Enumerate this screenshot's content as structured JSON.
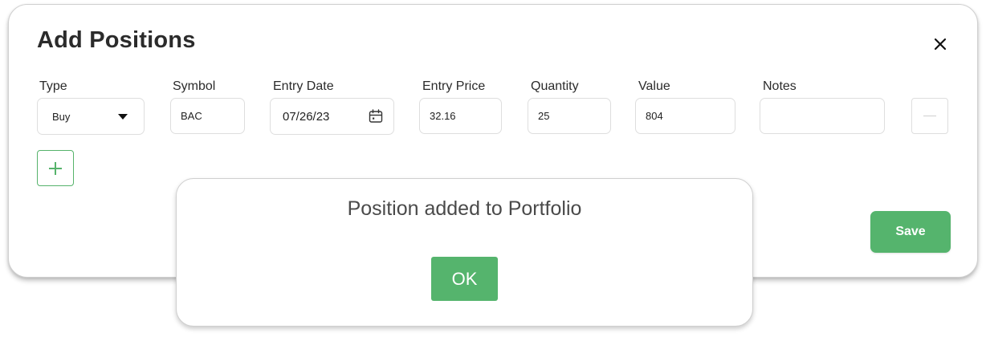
{
  "modal": {
    "title": "Add Positions",
    "close_icon": "close-icon",
    "columns": {
      "type_label": "Type",
      "symbol_label": "Symbol",
      "entry_date_label": "Entry Date",
      "entry_price_label": "Entry Price",
      "quantity_label": "Quantity",
      "value_label": "Value",
      "notes_label": "Notes"
    },
    "row": {
      "type": "Buy",
      "symbol": "BAC",
      "entry_date": "07/26/23",
      "entry_price": "32.16",
      "quantity": "25",
      "value": "804",
      "notes": ""
    },
    "add_row_icon": "plus-icon",
    "remove_row_icon": "minus-icon",
    "save_label": "Save"
  },
  "dialog": {
    "message": "Position added to Portfolio",
    "ok_label": "OK"
  },
  "colors": {
    "accent_green": "#55b46d",
    "text_dark": "#2b2b2b",
    "border_light": "#dedede"
  }
}
